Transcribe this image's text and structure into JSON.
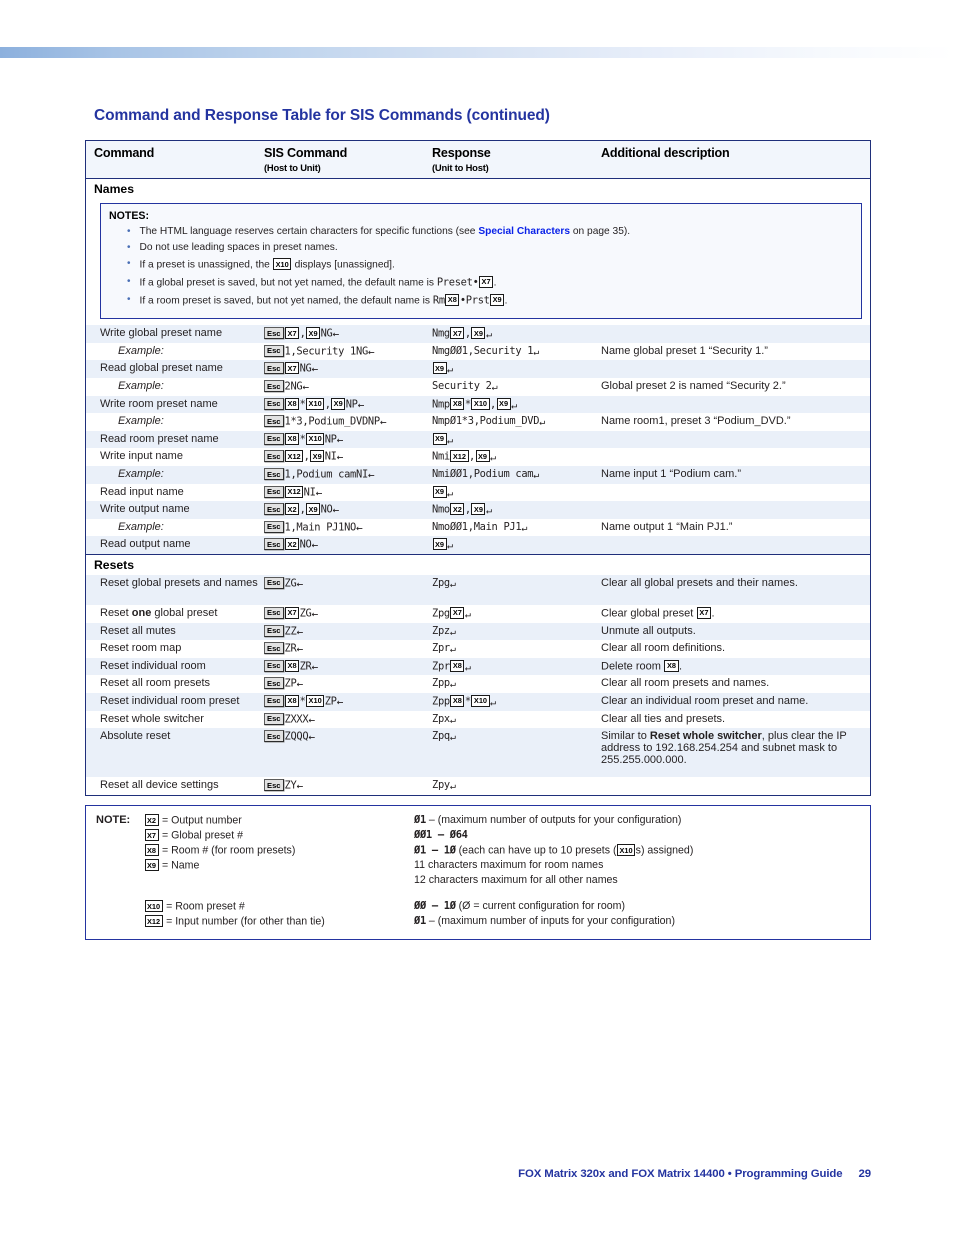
{
  "page": {
    "title": "Command and Response Table for SIS Commands (continued)",
    "footer_text": "FOX Matrix 320x and FOX Matrix 14400 • Programming Guide",
    "footer_page": "29",
    "accent_blue": "#2434a0",
    "link_blue": "#0a22e8",
    "stripe": "#eaf0f9",
    "header_bg": "#f2f6fc"
  },
  "table": {
    "headers": [
      {
        "main": "Command",
        "sub": ""
      },
      {
        "main": "SIS Command",
        "sub": "(Host to Unit)"
      },
      {
        "main": "Response",
        "sub": "(Unit to Host)"
      },
      {
        "main": "Additional description",
        "sub": ""
      }
    ],
    "sections": [
      {
        "name": "Names"
      },
      {
        "name": "Resets"
      }
    ],
    "notes_block": {
      "title": "NOTES:",
      "items": [
        {
          "pre": "The HTML language reserves certain characters for specific functions (see ",
          "link": "Special Characters",
          "post": " on page 35)."
        },
        {
          "pre": "Do not use leading spaces in preset names.",
          "link": "",
          "post": ""
        },
        {
          "pre": "If a preset is unassigned, the ",
          "var": "X10",
          "post": " displays [unassigned]."
        },
        {
          "pre": "If a global preset is saved, but not yet named, the default name is ",
          "mono_pre": "Preset•",
          "var": "X7",
          "post": "."
        },
        {
          "pre": "If a room preset is saved, but not yet named, the default name is ",
          "mono_pre": "Rm",
          "var": "X8",
          "mono_mid": "•Prst",
          "var2": "X9",
          "post": "."
        }
      ]
    },
    "names_rows": [
      {
        "command": "Write global preset name",
        "italic": false,
        "sis": [
          {
            "t": "esc",
            "v": "Esc"
          },
          {
            "t": "var",
            "v": "X7"
          },
          {
            "t": "mono",
            "v": ","
          },
          {
            "t": "var",
            "v": "X9"
          },
          {
            "t": "mono",
            "v": "NG"
          },
          {
            "t": "arrl",
            "v": "←"
          }
        ],
        "resp": [
          {
            "t": "mono",
            "v": "Nmg"
          },
          {
            "t": "var",
            "v": "X7"
          },
          {
            "t": "mono",
            "v": ","
          },
          {
            "t": "var",
            "v": "X9"
          },
          {
            "t": "arrr",
            "v": "↵"
          }
        ],
        "desc": ""
      },
      {
        "command": "Example:",
        "italic": true,
        "sis": [
          {
            "t": "esc",
            "v": "Esc"
          },
          {
            "t": "mono",
            "v": "1,Security 1NG"
          },
          {
            "t": "arrl",
            "v": "←"
          }
        ],
        "resp": [
          {
            "t": "mono",
            "v": "NmgØØ1,Security 1"
          },
          {
            "t": "arrr",
            "v": "↵"
          }
        ],
        "desc": "Name global preset 1 “Security 1.”"
      },
      {
        "command": "Read global preset name",
        "italic": false,
        "sis": [
          {
            "t": "esc",
            "v": "Esc"
          },
          {
            "t": "var",
            "v": "X7"
          },
          {
            "t": "mono",
            "v": "NG"
          },
          {
            "t": "arrl",
            "v": "←"
          }
        ],
        "resp": [
          {
            "t": "var",
            "v": "X9"
          },
          {
            "t": "arrr",
            "v": "↵"
          }
        ],
        "desc": ""
      },
      {
        "command": "Example:",
        "italic": true,
        "sis": [
          {
            "t": "esc",
            "v": "Esc"
          },
          {
            "t": "mono",
            "v": "2NG"
          },
          {
            "t": "arrl",
            "v": "←"
          }
        ],
        "resp": [
          {
            "t": "mono",
            "v": "Security 2"
          },
          {
            "t": "arrr",
            "v": "↵"
          }
        ],
        "desc": "Global preset 2 is named “Security 2.”"
      },
      {
        "command": "Write room preset name",
        "italic": false,
        "sis": [
          {
            "t": "esc",
            "v": "Esc"
          },
          {
            "t": "var",
            "v": "X8"
          },
          {
            "t": "mono",
            "v": "*"
          },
          {
            "t": "var",
            "v": "X10"
          },
          {
            "t": "mono",
            "v": ","
          },
          {
            "t": "var",
            "v": "X9"
          },
          {
            "t": "mono",
            "v": "NP"
          },
          {
            "t": "arrl",
            "v": "←"
          }
        ],
        "resp": [
          {
            "t": "mono",
            "v": "Nmp"
          },
          {
            "t": "var",
            "v": "X8"
          },
          {
            "t": "mono",
            "v": "*"
          },
          {
            "t": "var",
            "v": "X10"
          },
          {
            "t": "mono",
            "v": ","
          },
          {
            "t": "var",
            "v": "X9"
          },
          {
            "t": "arrr",
            "v": "↵"
          }
        ],
        "desc": ""
      },
      {
        "command": "Example:",
        "italic": true,
        "sis": [
          {
            "t": "esc",
            "v": "Esc"
          },
          {
            "t": "mono",
            "v": "1*3,Podium_DVDNP"
          },
          {
            "t": "arrl",
            "v": "←"
          }
        ],
        "resp": [
          {
            "t": "mono",
            "v": "NmpØ1*3,Podium_DVD"
          },
          {
            "t": "arrr",
            "v": "↵"
          }
        ],
        "desc": "Name room1, preset 3 “Podium_DVD.”"
      },
      {
        "command": "Read room preset name",
        "italic": false,
        "sis": [
          {
            "t": "esc",
            "v": "Esc"
          },
          {
            "t": "var",
            "v": "X8"
          },
          {
            "t": "mono",
            "v": "*"
          },
          {
            "t": "var",
            "v": "X10"
          },
          {
            "t": "mono",
            "v": "NP"
          },
          {
            "t": "arrl",
            "v": "←"
          }
        ],
        "resp": [
          {
            "t": "var",
            "v": "X9"
          },
          {
            "t": "arrr",
            "v": "↵"
          }
        ],
        "desc": ""
      },
      {
        "command": "Write input name",
        "italic": false,
        "sis": [
          {
            "t": "esc",
            "v": "Esc"
          },
          {
            "t": "var",
            "v": "X12"
          },
          {
            "t": "mono",
            "v": ","
          },
          {
            "t": "var",
            "v": "X9"
          },
          {
            "t": "mono",
            "v": "NI"
          },
          {
            "t": "arrl",
            "v": "←"
          }
        ],
        "resp": [
          {
            "t": "mono",
            "v": "Nmi"
          },
          {
            "t": "var",
            "v": "X12"
          },
          {
            "t": "mono",
            "v": ","
          },
          {
            "t": "var",
            "v": "X9"
          },
          {
            "t": "arrr",
            "v": "↵"
          }
        ],
        "desc": ""
      },
      {
        "command": "Example:",
        "italic": true,
        "sis": [
          {
            "t": "esc",
            "v": "Esc"
          },
          {
            "t": "mono",
            "v": "1,Podium camNI"
          },
          {
            "t": "arrl",
            "v": "←"
          }
        ],
        "resp": [
          {
            "t": "mono",
            "v": "NmiØØ1,Podium cam"
          },
          {
            "t": "arrr",
            "v": "↵"
          }
        ],
        "desc": "Name input 1 “Podium cam.”"
      },
      {
        "command": "Read input name",
        "italic": false,
        "sis": [
          {
            "t": "esc",
            "v": "Esc"
          },
          {
            "t": "var",
            "v": "X12"
          },
          {
            "t": "mono",
            "v": "NI"
          },
          {
            "t": "arrl",
            "v": "←"
          }
        ],
        "resp": [
          {
            "t": "var",
            "v": "X9"
          },
          {
            "t": "arrr",
            "v": "↵"
          }
        ],
        "desc": ""
      },
      {
        "command": "Write output name",
        "italic": false,
        "sis": [
          {
            "t": "esc",
            "v": "Esc"
          },
          {
            "t": "var",
            "v": "X2"
          },
          {
            "t": "mono",
            "v": ","
          },
          {
            "t": "var",
            "v": "X9"
          },
          {
            "t": "mono",
            "v": "NO"
          },
          {
            "t": "arrl",
            "v": "←"
          }
        ],
        "resp": [
          {
            "t": "mono",
            "v": "Nmo"
          },
          {
            "t": "var",
            "v": "X2"
          },
          {
            "t": "mono",
            "v": ","
          },
          {
            "t": "var",
            "v": "X9"
          },
          {
            "t": "arrr",
            "v": "↵"
          }
        ],
        "desc": ""
      },
      {
        "command": "Example:",
        "italic": true,
        "sis": [
          {
            "t": "esc",
            "v": "Esc"
          },
          {
            "t": "mono",
            "v": "1,Main PJ1NO"
          },
          {
            "t": "arrl",
            "v": "←"
          }
        ],
        "resp": [
          {
            "t": "mono",
            "v": "NmoØØ1,Main PJ1"
          },
          {
            "t": "arrr",
            "v": "↵"
          }
        ],
        "desc": "Name output 1 “Main PJ1.”"
      },
      {
        "command": "Read output name",
        "italic": false,
        "sis": [
          {
            "t": "esc",
            "v": "Esc"
          },
          {
            "t": "var",
            "v": "X2"
          },
          {
            "t": "mono",
            "v": "NO"
          },
          {
            "t": "arrl",
            "v": "←"
          }
        ],
        "resp": [
          {
            "t": "var",
            "v": "X9"
          },
          {
            "t": "arrr",
            "v": "↵"
          }
        ],
        "desc": ""
      }
    ],
    "resets_rows": [
      {
        "command": "Reset global presets and names",
        "italic": false,
        "height": "tall",
        "sis": [
          {
            "t": "esc",
            "v": "Esc"
          },
          {
            "t": "mono",
            "v": "ZG"
          },
          {
            "t": "arrl",
            "v": "←"
          }
        ],
        "resp": [
          {
            "t": "mono",
            "v": "Zpg"
          },
          {
            "t": "arrr",
            "v": "↵"
          }
        ],
        "desc": "Clear all global presets and their names."
      },
      {
        "command": "Reset one global preset",
        "bold_word": "one",
        "italic": false,
        "sis": [
          {
            "t": "esc",
            "v": "Esc"
          },
          {
            "t": "var",
            "v": "X7"
          },
          {
            "t": "mono",
            "v": "ZG"
          },
          {
            "t": "arrl",
            "v": "←"
          }
        ],
        "resp": [
          {
            "t": "mono",
            "v": "Zpg"
          },
          {
            "t": "var",
            "v": "X7"
          },
          {
            "t": "arrr",
            "v": "↵"
          }
        ],
        "desc_pre": "Clear global preset ",
        "desc_var": "X7",
        "desc_post": "."
      },
      {
        "command": "Reset all mutes",
        "italic": false,
        "sis": [
          {
            "t": "esc",
            "v": "Esc"
          },
          {
            "t": "mono",
            "v": "ZZ"
          },
          {
            "t": "arrl",
            "v": "←"
          }
        ],
        "resp": [
          {
            "t": "mono",
            "v": "Zpz"
          },
          {
            "t": "arrr",
            "v": "↵"
          }
        ],
        "desc": "Unmute all outputs."
      },
      {
        "command": "Reset room map",
        "italic": false,
        "sis": [
          {
            "t": "esc",
            "v": "Esc"
          },
          {
            "t": "mono",
            "v": "ZR"
          },
          {
            "t": "arrl",
            "v": "←"
          }
        ],
        "resp": [
          {
            "t": "mono",
            "v": "Zpr"
          },
          {
            "t": "arrr",
            "v": "↵"
          }
        ],
        "desc": "Clear all room definitions."
      },
      {
        "command": "Reset individual room",
        "italic": false,
        "sis": [
          {
            "t": "esc",
            "v": "Esc"
          },
          {
            "t": "var",
            "v": "X8"
          },
          {
            "t": "mono",
            "v": "ZR"
          },
          {
            "t": "arrl",
            "v": "←"
          }
        ],
        "resp": [
          {
            "t": "mono",
            "v": "Zpr"
          },
          {
            "t": "var",
            "v": "X8"
          },
          {
            "t": "arrr",
            "v": "↵"
          }
        ],
        "desc_pre": "Delete room ",
        "desc_var": "X8",
        "desc_post": "."
      },
      {
        "command": "Reset all room presets",
        "italic": false,
        "sis": [
          {
            "t": "esc",
            "v": "Esc"
          },
          {
            "t": "mono",
            "v": "ZP"
          },
          {
            "t": "arrl",
            "v": "←"
          }
        ],
        "resp": [
          {
            "t": "mono",
            "v": "Zpp"
          },
          {
            "t": "arrr",
            "v": "↵"
          }
        ],
        "desc": "Clear all room presets and names."
      },
      {
        "command": "Reset individual room preset",
        "italic": false,
        "sis": [
          {
            "t": "esc",
            "v": "Esc"
          },
          {
            "t": "var",
            "v": "X8"
          },
          {
            "t": "mono",
            "v": "*"
          },
          {
            "t": "var",
            "v": "X10"
          },
          {
            "t": "mono",
            "v": "ZP"
          },
          {
            "t": "arrl",
            "v": "←"
          }
        ],
        "resp": [
          {
            "t": "mono",
            "v": "Zpp"
          },
          {
            "t": "var",
            "v": "X8"
          },
          {
            "t": "mono",
            "v": "*"
          },
          {
            "t": "var",
            "v": "X10"
          },
          {
            "t": "arrr",
            "v": "↵"
          }
        ],
        "desc": "Clear an individual room preset and name."
      },
      {
        "command": "Reset whole switcher",
        "italic": false,
        "sis": [
          {
            "t": "esc",
            "v": "Esc"
          },
          {
            "t": "mono",
            "v": "ZXXX"
          },
          {
            "t": "arrl",
            "v": "←"
          }
        ],
        "resp": [
          {
            "t": "mono",
            "v": "Zpx"
          },
          {
            "t": "arrr",
            "v": "↵"
          }
        ],
        "desc": "Clear all ties and presets."
      },
      {
        "command": "Absolute reset",
        "italic": false,
        "height": "xtall",
        "sis": [
          {
            "t": "esc",
            "v": "Esc"
          },
          {
            "t": "mono",
            "v": "ZQQQ"
          },
          {
            "t": "arrl",
            "v": "←"
          }
        ],
        "resp": [
          {
            "t": "mono",
            "v": "Zpq"
          },
          {
            "t": "arrr",
            "v": "↵"
          }
        ],
        "desc_pre": "Similar to ",
        "desc_bold": "Reset whole switcher",
        "desc_post": ", plus clear the IP address to 192.168.254.254 and subnet mask to 255.255.000.000."
      },
      {
        "command": "Reset all device settings",
        "italic": false,
        "sis": [
          {
            "t": "esc",
            "v": "Esc"
          },
          {
            "t": "mono",
            "v": "ZY"
          },
          {
            "t": "arrl",
            "v": "←"
          }
        ],
        "resp": [
          {
            "t": "mono",
            "v": "Zpy"
          },
          {
            "t": "arrr",
            "v": "↵"
          }
        ],
        "desc": ""
      }
    ]
  },
  "note_box": {
    "label": "NOTE:",
    "lines": [
      {
        "var": "X2",
        "left": "= Output number",
        "right": "Ø1 – (maximum number of outputs for your configuration)",
        "right_bold_prefix": "Ø1"
      },
      {
        "var": "X7",
        "left": "= Global preset #",
        "right": "ØØ1 – Ø64",
        "right_bold_prefix": "ØØ1 – Ø64"
      },
      {
        "var": "X8",
        "left": "= Room # (for room presets)",
        "right": "Ø1 – 1Ø (each can have up to 10 presets (X10s) assigned)",
        "right_bold_prefix": "Ø1 – 1Ø"
      },
      {
        "var": "X9",
        "left": "= Name",
        "right": "11 characters maximum for room names",
        "right_bold_prefix": ""
      },
      {
        "var": "",
        "left": "",
        "right": "12 characters maximum for all other names",
        "right_bold_prefix": ""
      },
      {
        "var": "X10",
        "left": "= Room preset #",
        "right": "ØØ – 1Ø (Ø = current configuration for room)",
        "right_bold_prefix": "ØØ – 1Ø"
      },
      {
        "var": "X12",
        "left": "= Input number (for other than tie)",
        "right": "Ø1 – (maximum number of inputs for your configuration)",
        "right_bold_prefix": "Ø1"
      }
    ]
  }
}
